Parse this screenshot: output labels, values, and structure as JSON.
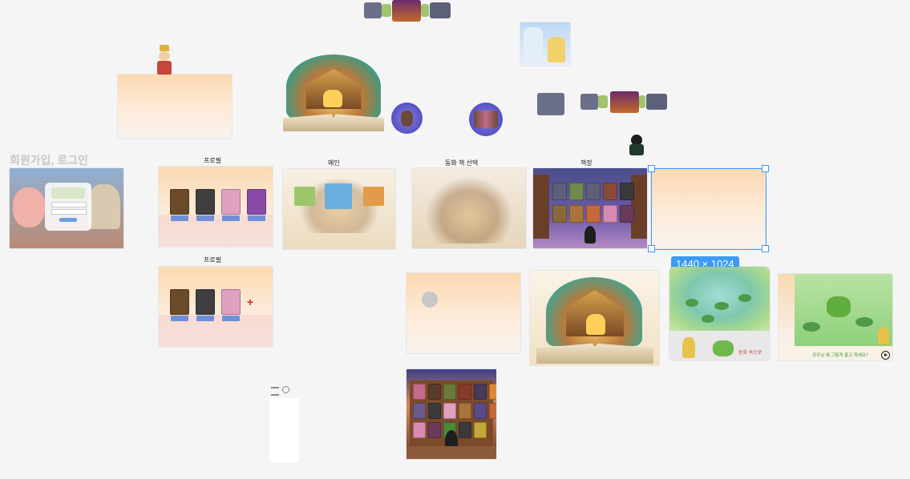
{
  "canvas": {
    "frames": [
      {
        "label": "프로필"
      },
      {
        "label": "메인"
      },
      {
        "label": "동화 책 선택"
      },
      {
        "label": "책장"
      },
      {
        "label": "프로필"
      }
    ],
    "signup_title": "회원가입, 로그인",
    "selection_size": "1440 × 1024",
    "pond_frame_caption": "동화 속으로",
    "frog_frame_caption": "공주님 왜 그렇게 울고 계세요?",
    "profile_cards": [
      "엄마",
      "아빠",
      "누나",
      "나"
    ],
    "profile2_cards": [
      "엄마",
      "아빠",
      "누나"
    ],
    "profile2_add": "+"
  },
  "colors": {
    "selection": "#3b9bf5",
    "canvas_bg": "#f5f5f5",
    "peach": "#fbd9b1"
  }
}
